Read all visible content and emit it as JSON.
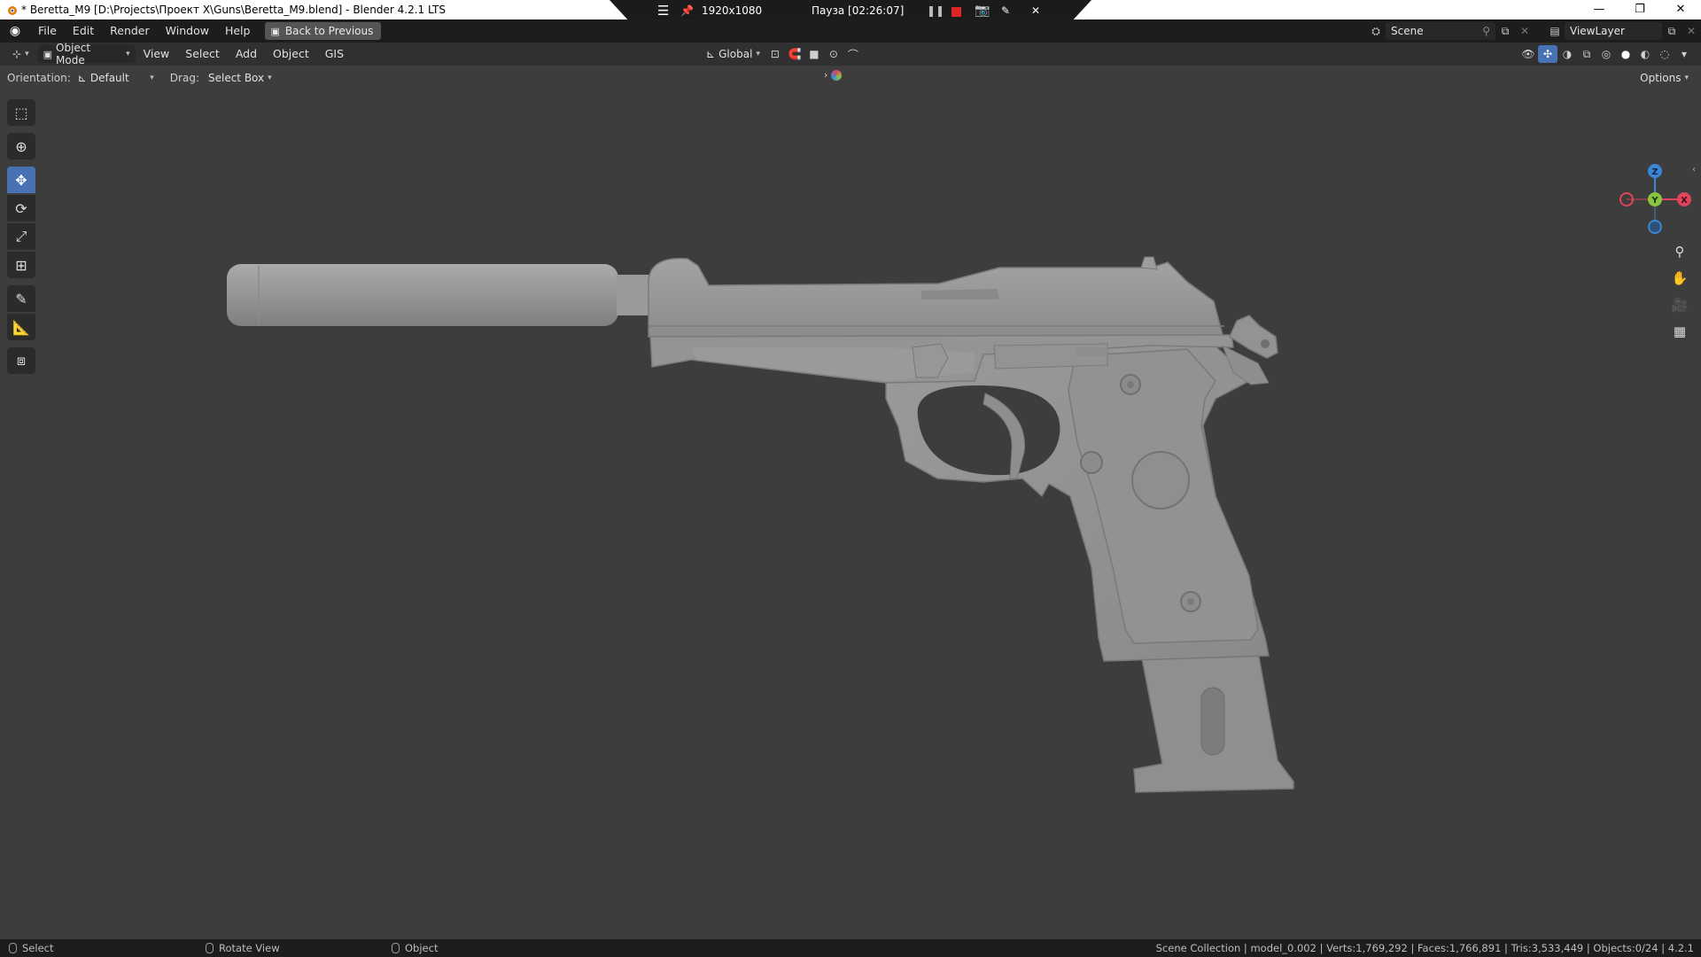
{
  "window": {
    "title": "* Beretta_M9 [D:\\Projects\\Проект X\\Guns\\Beretta_M9.blend] - Blender 4.2.1 LTS",
    "controls": {
      "minimize": "—",
      "restore": "❐",
      "close": "✕"
    }
  },
  "recorder": {
    "resolution": "1920x1080",
    "status": "Пауза [02:26:07]"
  },
  "topbar": {
    "menus": [
      "File",
      "Edit",
      "Render",
      "Window",
      "Help"
    ],
    "back_label": "Back to Previous",
    "scene": "Scene",
    "view_layer": "ViewLayer"
  },
  "viewport_header": {
    "mode": "Object Mode",
    "menus": [
      "View",
      "Select",
      "Add",
      "Object",
      "GIS"
    ],
    "transform_orientation": "Global"
  },
  "tool_settings": {
    "orientation_label": "Orientation:",
    "orientation_value": "Default",
    "drag_label": "Drag:",
    "drag_value": "Select Box",
    "options_label": "Options"
  },
  "gizmo": {
    "z": "Z",
    "y": "Y",
    "x": "X"
  },
  "statusbar": {
    "select": "Select",
    "rotate": "Rotate View",
    "object": "Object",
    "stats": "Scene Collection | model_0.002 | Verts:1,769,292 | Faces:1,766,891 | Tris:3,533,449 | Objects:0/24 | 4.2.1"
  },
  "colors": {
    "accent": "#4772b3",
    "axis_x": "#e0455a",
    "axis_y": "#8bc53f",
    "axis_z": "#3d86d6",
    "rec_stop": "#e02424"
  },
  "icons": [
    "blender-logo-icon",
    "select-box-icon",
    "cursor-icon",
    "move-icon",
    "rotate-icon",
    "scale-icon",
    "transform-icon",
    "annotate-icon",
    "measure-icon",
    "add-cube-icon",
    "zoom-icon",
    "hand-icon",
    "camera-icon",
    "grid-icon"
  ]
}
